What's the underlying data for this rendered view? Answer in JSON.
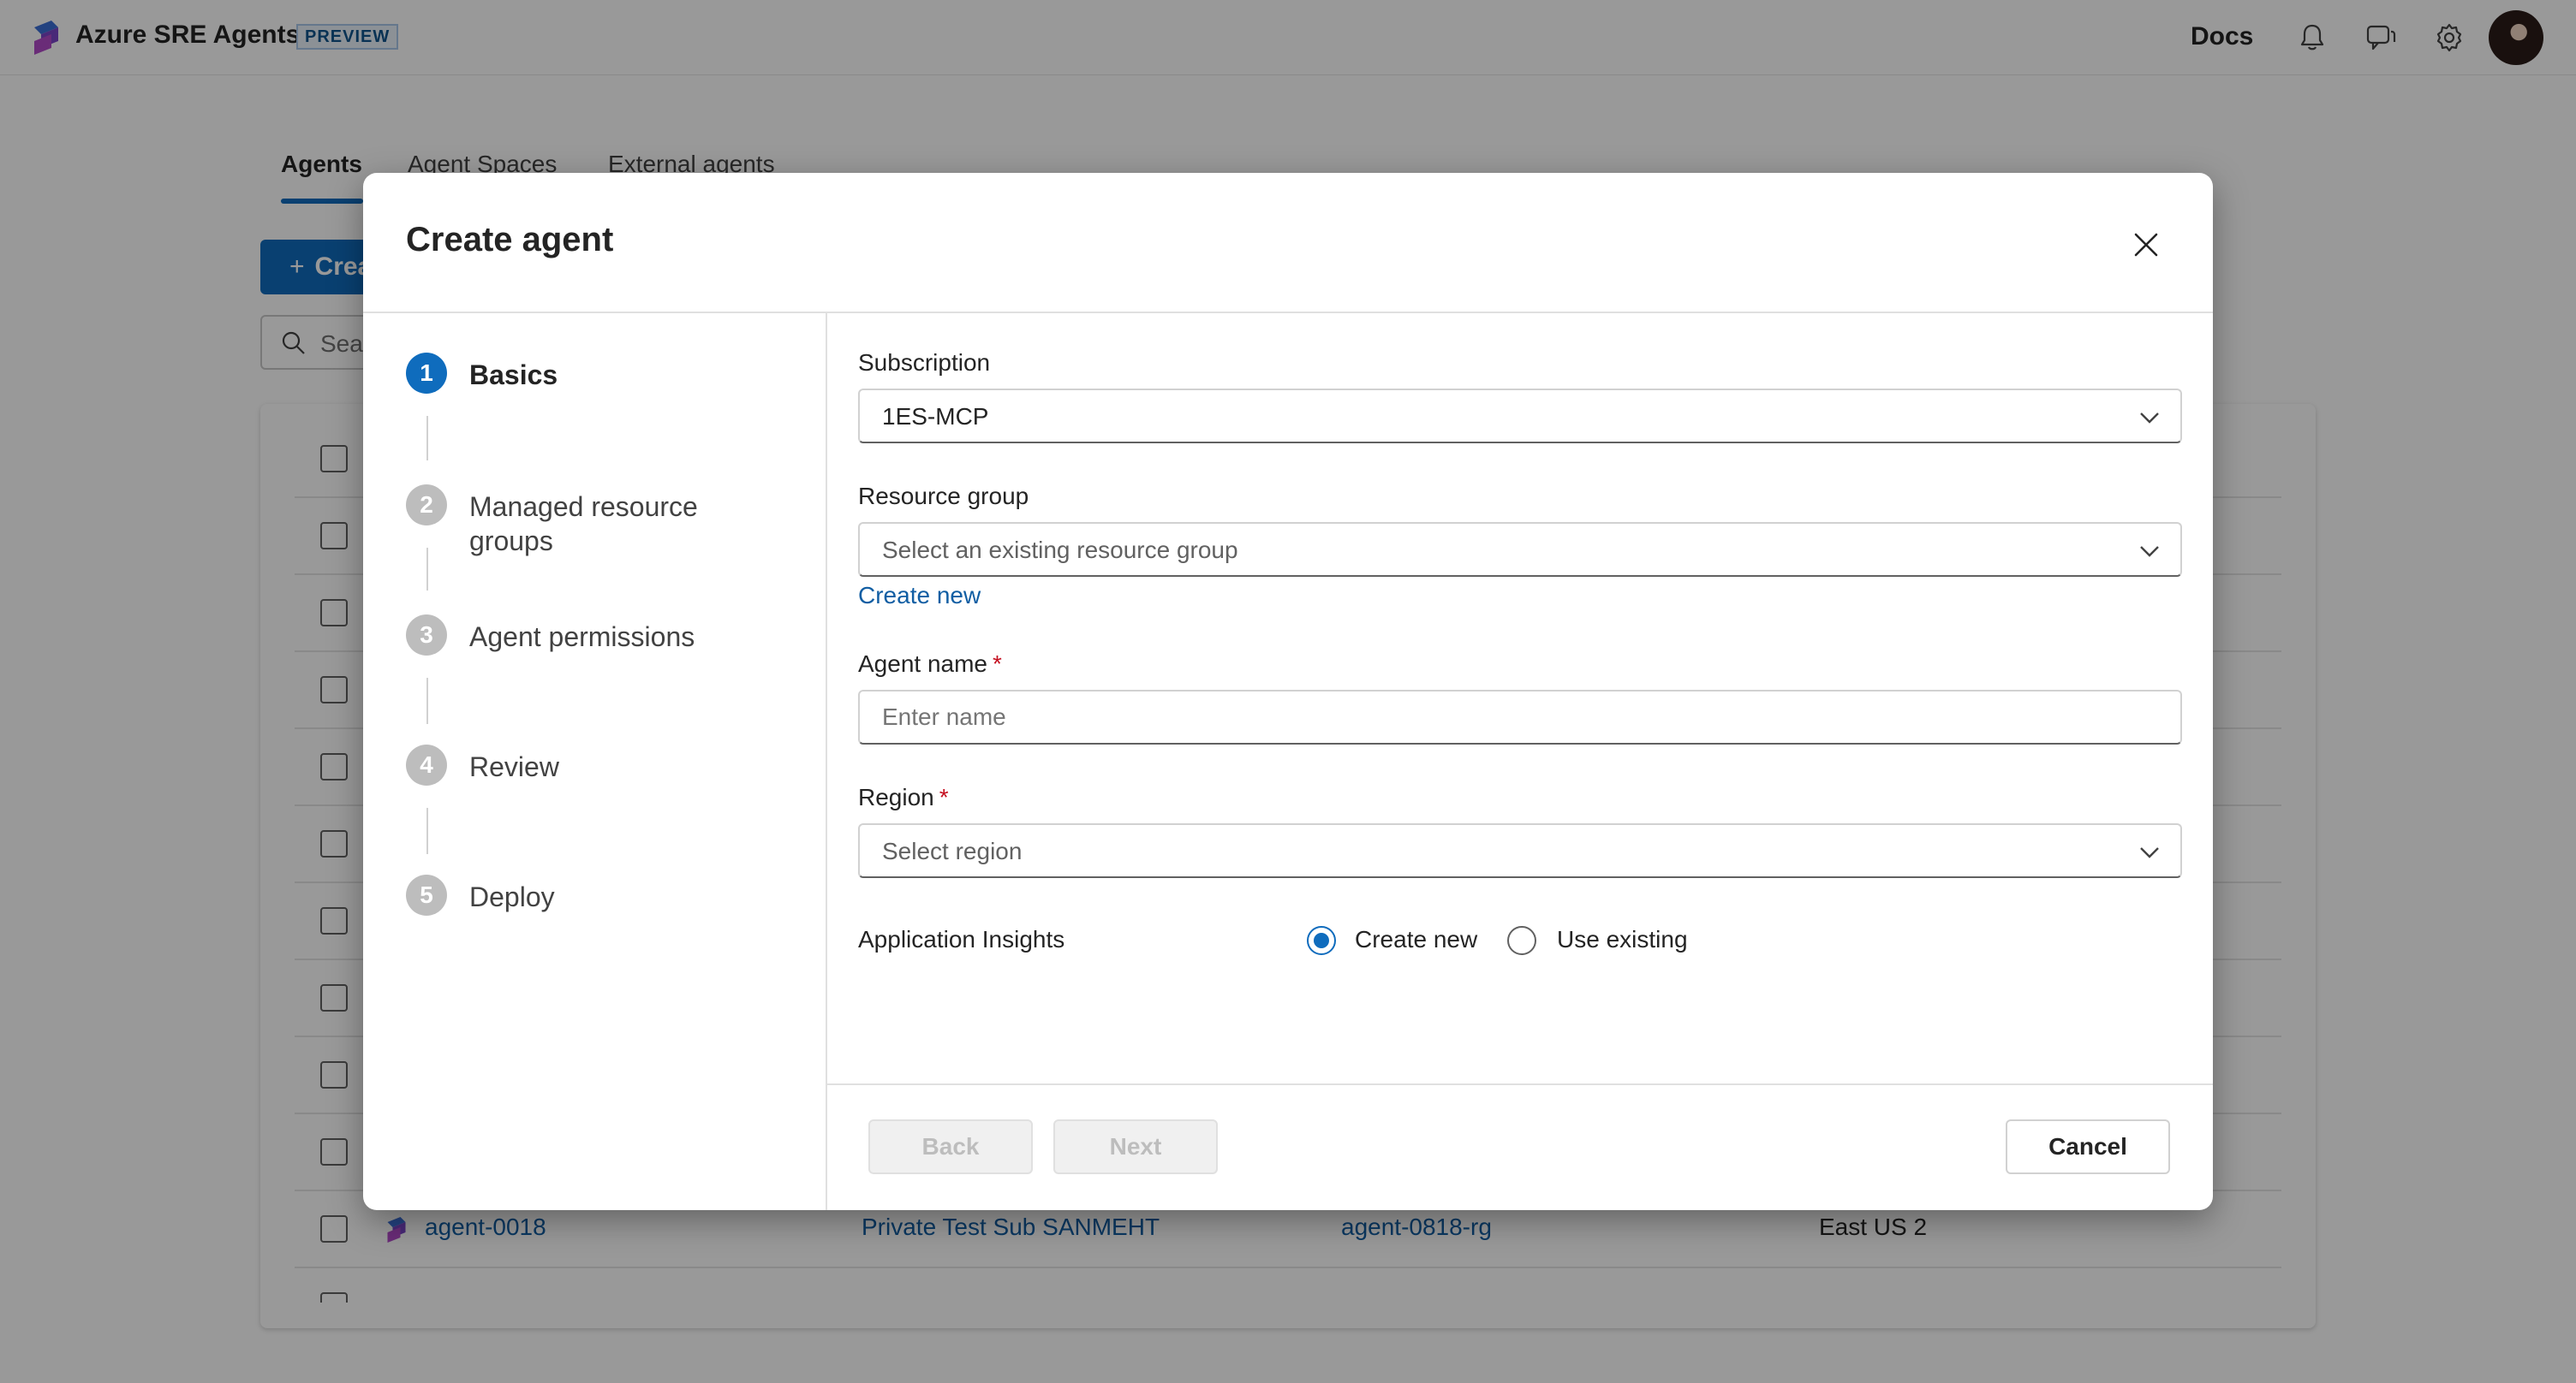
{
  "header": {
    "app_title": "Azure SRE Agents",
    "preview_badge": "PREVIEW",
    "docs_label": "Docs",
    "icons": [
      "brand-logo-icon",
      "bell-icon",
      "feedback-icon",
      "gear-icon"
    ]
  },
  "tabs": [
    {
      "label": "Agents",
      "active": true
    },
    {
      "label": "Agent Spaces",
      "active": false
    },
    {
      "label": "External agents",
      "active": false
    }
  ],
  "toolbar": {
    "create_label": "Create",
    "search_placeholder": "Search"
  },
  "agents_list": {
    "visible_row": {
      "name": "agent-0018",
      "subscription": "Private Test Sub SANMEHT",
      "resource_group": "agent-0818-rg",
      "region": "East US 2"
    }
  },
  "dialog": {
    "title": "Create agent",
    "steps": [
      {
        "number": "1",
        "label": "Basics",
        "active": true
      },
      {
        "number": "2",
        "label": "Managed resource groups",
        "active": false
      },
      {
        "number": "3",
        "label": "Agent permissions",
        "active": false
      },
      {
        "number": "4",
        "label": "Review",
        "active": false
      },
      {
        "number": "5",
        "label": "Deploy",
        "active": false
      }
    ],
    "subscription": {
      "label": "Subscription",
      "value": "1ES-MCP"
    },
    "resource_group": {
      "label": "Resource group",
      "placeholder": "Select an existing resource group",
      "create_new": "Create new"
    },
    "agent_name": {
      "label": "Agent name",
      "required_mark": "*",
      "placeholder": "Enter name",
      "value": ""
    },
    "region": {
      "label": "Region",
      "required_mark": "*",
      "placeholder": "Select region"
    },
    "app_insights": {
      "label": "Application Insights",
      "options": [
        {
          "label": "Create new",
          "checked": true
        },
        {
          "label": "Use existing",
          "checked": false
        }
      ]
    },
    "buttons": {
      "back": "Back",
      "next": "Next",
      "cancel": "Cancel"
    }
  },
  "colors": {
    "accent": "#0f6cbd",
    "link": "#115ea3",
    "required": "#c50f1f",
    "overlay": "rgba(0,0,0,0.4)"
  }
}
